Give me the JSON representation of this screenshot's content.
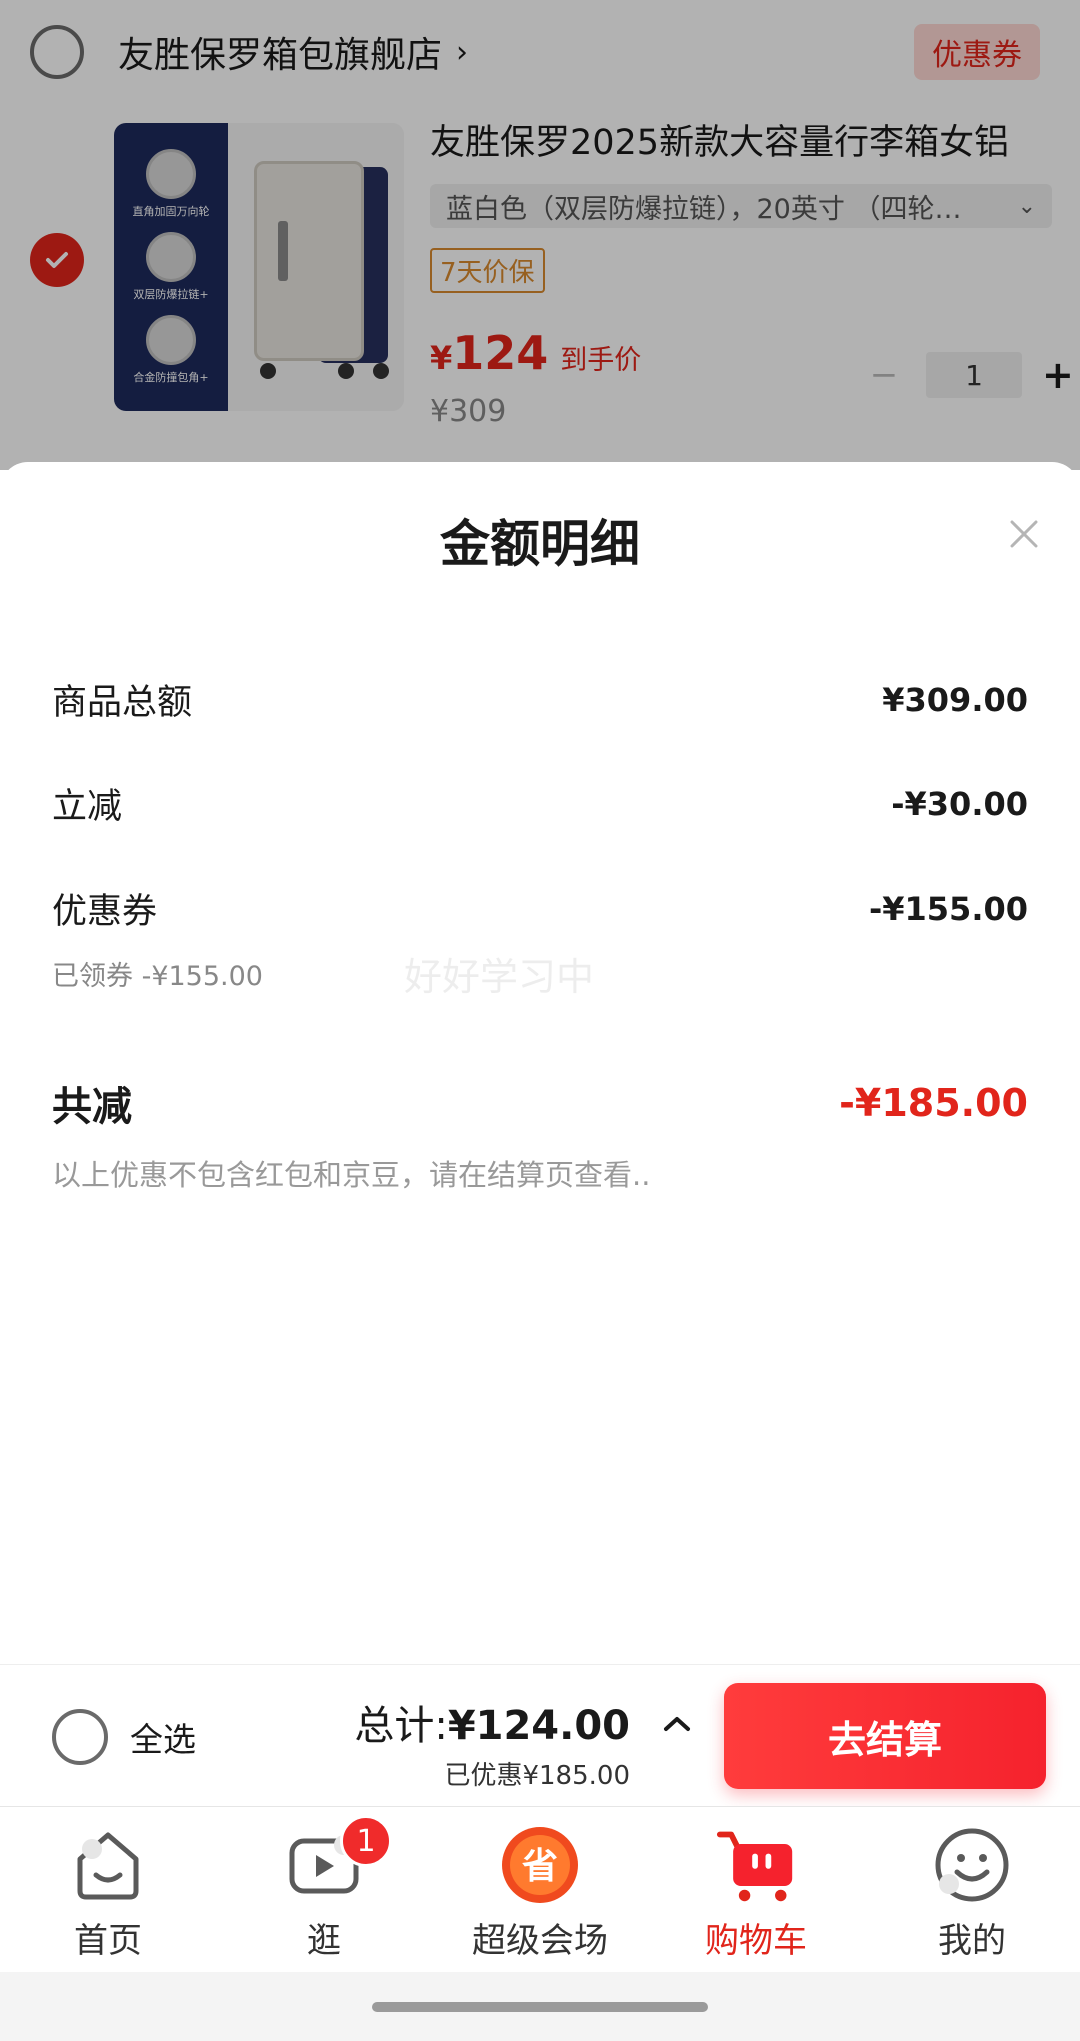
{
  "store": {
    "name": "友胜保罗箱包旗舰店",
    "chevron": "›",
    "coupon_tag": "优惠券"
  },
  "product": {
    "title": "友胜保罗2025新款大容量行李箱女铝",
    "spec": "蓝白色（双层防爆拉链），20英寸 （四轮…",
    "spec_chevron": "⌄",
    "price_protect": "7天价保",
    "deal_yen": "¥",
    "deal_price": "124",
    "deal_label": "到手价",
    "original_price": "¥309",
    "features": [
      "直角加固万向轮",
      "双层防爆拉链+",
      "合金防撞包角+"
    ],
    "quantity": "1",
    "minus": "−",
    "plus": "+"
  },
  "sheet": {
    "title": "金额明细",
    "rows": {
      "goods_total": {
        "label": "商品总额",
        "value": "¥309.00"
      },
      "instant_reduce": {
        "label": "立减",
        "value": "-¥30.00"
      },
      "coupon": {
        "label": "优惠券",
        "value": "-¥155.00",
        "sub": "已领券 -¥155.00"
      },
      "total_reduce": {
        "label": "共减",
        "value": "-¥185.00"
      }
    },
    "watermark": "好好学习中",
    "note": "以上优惠不包含红包和京豆，请在结算页查看.."
  },
  "checkout": {
    "select_all": "全选",
    "total_label": "总计:",
    "total_amount": "¥124.00",
    "saved": "已优惠¥185.00",
    "pay_button": "去结算"
  },
  "tabs": [
    {
      "label": "首页",
      "icon": "home-icon"
    },
    {
      "label": "逛",
      "icon": "video-play-icon",
      "badge": "1"
    },
    {
      "label": "超级会场",
      "icon": "super-venue-icon",
      "glyph": "省"
    },
    {
      "label": "购物车",
      "icon": "cart-icon",
      "active": true
    },
    {
      "label": "我的",
      "icon": "smiley-icon"
    }
  ],
  "colors": {
    "brand_red": "#e1251b",
    "price_protect": "#d98a2e"
  }
}
